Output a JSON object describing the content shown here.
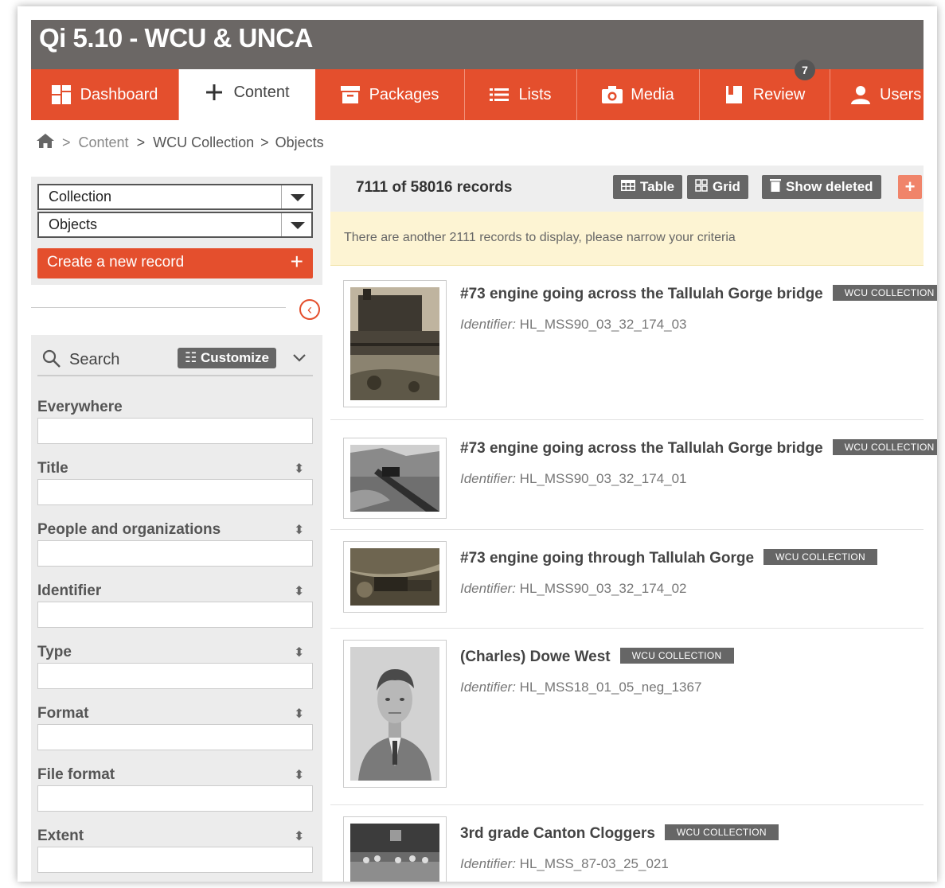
{
  "app": {
    "title": "Qi 5.10 - WCU & UNCA"
  },
  "nav": {
    "items": [
      {
        "label": "Dashboard",
        "icon": "dashboard-icon"
      },
      {
        "label": "Content",
        "icon": "plus-icon"
      },
      {
        "label": "Packages",
        "icon": "archive-box-icon"
      },
      {
        "label": "Lists",
        "icon": "list-icon"
      },
      {
        "label": "Media",
        "icon": "camera-icon"
      },
      {
        "label": "Review",
        "icon": "bookmark-icon",
        "badge": "7"
      },
      {
        "label": "Users",
        "icon": "user-icon"
      }
    ],
    "active": "Content"
  },
  "breadcrumb": {
    "home_icon": "home-icon",
    "sep": ">",
    "items": [
      "Content",
      "WCU Collection",
      "Objects"
    ]
  },
  "left": {
    "collection_select": "Collection",
    "objects_select": "Objects",
    "create_label": "Create a new record",
    "create_plus": "+",
    "search_label": "Search",
    "customize_label": "Customize",
    "fields": [
      "Everywhere",
      "Title",
      "People and organizations",
      "Identifier",
      "Type",
      "Format",
      "File format",
      "Extent"
    ]
  },
  "toolbar": {
    "records": "7111 of 58016 records",
    "table_label": "Table",
    "grid_label": "Grid",
    "deleted_label": "Show deleted",
    "add_label": "+"
  },
  "notice": "There are another 2111 records to display, please narrow your criteria",
  "records": [
    {
      "title": "#73 engine going across the Tallulah Gorge bridge",
      "tag": "WCU COLLECTION",
      "id_label": "Identifier:",
      "id": "HL_MSS90_03_32_174_03"
    },
    {
      "title": "#73 engine going across the Tallulah Gorge bridge",
      "tag": "WCU COLLECTION",
      "id_label": "Identifier:",
      "id": "HL_MSS90_03_32_174_01"
    },
    {
      "title": "#73 engine going through Tallulah Gorge",
      "tag": "WCU COLLECTION",
      "id_label": "Identifier:",
      "id": "HL_MSS90_03_32_174_02"
    },
    {
      "title": "(Charles) Dowe West",
      "tag": "WCU COLLECTION",
      "id_label": "Identifier:",
      "id": "HL_MSS18_01_05_neg_1367"
    },
    {
      "title": "3rd grade Canton Cloggers",
      "tag": "WCU COLLECTION",
      "id_label": "Identifier:",
      "id": "HL_MSS_87-03_25_021"
    }
  ],
  "colors": {
    "brand": "#e44f2d",
    "header": "#6b6765",
    "notice_bg": "#fdf4d3",
    "tag_bg": "#666666"
  }
}
